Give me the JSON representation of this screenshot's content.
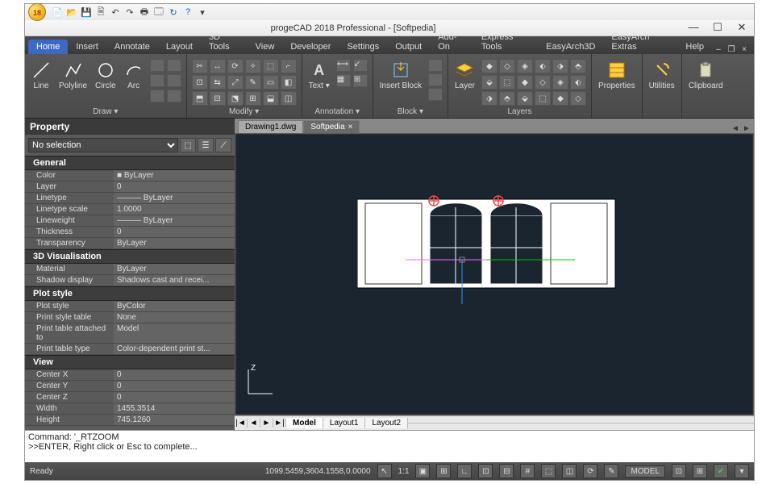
{
  "app": {
    "title": "progeCAD 2018 Professional - [Softpedia]",
    "badge": "18"
  },
  "winctl": {
    "min": "—",
    "max": "☐",
    "close": "✕"
  },
  "mdi": {
    "min": "–",
    "max": "❐",
    "close": "×"
  },
  "qat": [
    "new",
    "open",
    "save",
    "undo",
    "redo",
    "plot",
    "preview",
    "find",
    "help",
    "dropdown"
  ],
  "menu": {
    "tabs": [
      "Home",
      "Insert",
      "Annotate",
      "Layout",
      "3D Tools",
      "View",
      "Developer",
      "Settings",
      "Output",
      "Add-On",
      "Express Tools",
      "EasyArch3D",
      "EasyArch Extras",
      "Help"
    ],
    "active": 0
  },
  "ribbon": {
    "draw": {
      "label": "Draw ▾",
      "items": [
        "Line",
        "Polyline",
        "Circle",
        "Arc"
      ]
    },
    "modify": {
      "label": "Modify ▾"
    },
    "annotation": {
      "label": "Annotation ▾",
      "items": [
        "Text ▾"
      ]
    },
    "block": {
      "label": "Block ▾",
      "items": [
        "Insert\nBlock"
      ]
    },
    "layers": {
      "label": "Layers",
      "items": [
        "Layer"
      ]
    },
    "properties": {
      "label": "Properties"
    },
    "utilities": {
      "label": "Utilities"
    },
    "clipboard": {
      "label": "Clipboard"
    }
  },
  "property": {
    "title": "Property",
    "selection": "No selection",
    "groups": [
      {
        "name": "General",
        "rows": [
          {
            "k": "Color",
            "v": "■ ByLayer"
          },
          {
            "k": "Layer",
            "v": "0"
          },
          {
            "k": "Linetype",
            "v": "——— ByLayer"
          },
          {
            "k": "Linetype scale",
            "v": "1.0000"
          },
          {
            "k": "Lineweight",
            "v": "——— ByLayer"
          },
          {
            "k": "Thickness",
            "v": "0"
          },
          {
            "k": "Transparency",
            "v": "ByLayer"
          }
        ]
      },
      {
        "name": "3D Visualisation",
        "rows": [
          {
            "k": "Material",
            "v": "ByLayer"
          },
          {
            "k": "Shadow display",
            "v": "Shadows cast and recei..."
          }
        ]
      },
      {
        "name": "Plot style",
        "rows": [
          {
            "k": "Plot style",
            "v": "ByColor"
          },
          {
            "k": "Print style table",
            "v": "None"
          },
          {
            "k": "Print table attached to",
            "v": "Model"
          },
          {
            "k": "Print table type",
            "v": "Color-dependent print st..."
          }
        ]
      },
      {
        "name": "View",
        "rows": [
          {
            "k": "Center X",
            "v": "0"
          },
          {
            "k": "Center Y",
            "v": "0"
          },
          {
            "k": "Center Z",
            "v": "0"
          },
          {
            "k": "Width",
            "v": "1455.3514"
          },
          {
            "k": "Height",
            "v": "745.1260"
          }
        ]
      }
    ]
  },
  "doctabs": {
    "tabs": [
      "Drawing1.dwg",
      "Softpedia"
    ],
    "active": 1,
    "nav": [
      "◄",
      "►"
    ]
  },
  "layout": {
    "nav": [
      "|◄",
      "◄",
      "►",
      "►|"
    ],
    "tabs": [
      "Model",
      "Layout1",
      "Layout2"
    ],
    "active": 0
  },
  "ucs": {
    "z": "Z"
  },
  "cmd": {
    "line1": "Command: '_RTZOOM",
    "line2": ">>ENTER, Right click or Esc to complete..."
  },
  "status": {
    "ready": "Ready",
    "coords": "1099.5459,3604.1558,0.0000",
    "scale": "1:1",
    "model": "MODEL"
  }
}
